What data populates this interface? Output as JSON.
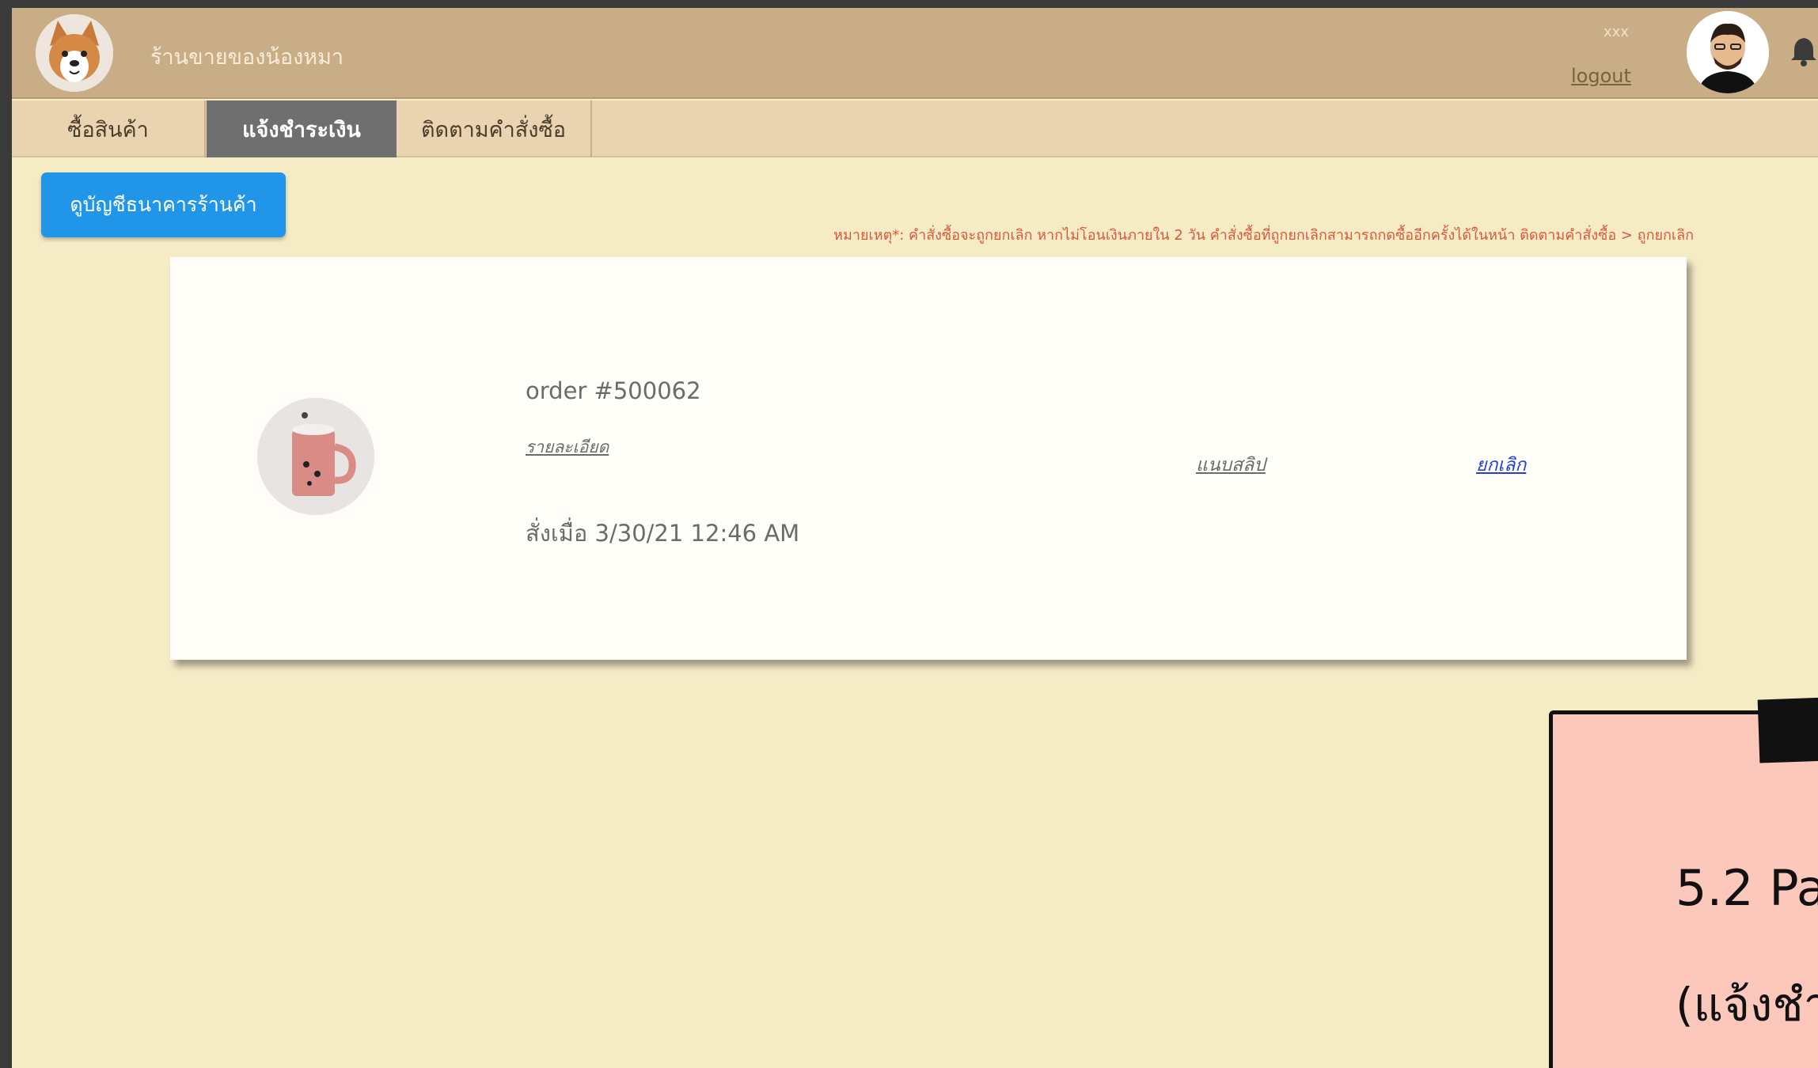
{
  "header": {
    "shop_name": "ร้านขายของน้องหมา",
    "user_name": "xxx",
    "logout_label": "logout",
    "logo_icon": "corgi-logo",
    "avatar_icon": "user-avatar",
    "bell_icon": "bell-icon"
  },
  "tabs": [
    {
      "label": "ซื้อสินค้า"
    },
    {
      "label": "แจ้งชำระเงิน",
      "active": true
    },
    {
      "label": "ติดตามคำสั่งซื้อ"
    }
  ],
  "bank_button_label": "ดูบัญชีธนาคารร้านค้า",
  "note": "หมายเหตุ*: คำสั่งซื้อจะถูกยกเลิก หากไม่โอนเงินภายใน 2 วัน คำสั่งซื้อที่ถูกยกเลิกสามารถกดซื้ออีกครั้งได้ในหน้า ติดตามคำสั่งซื้อ > ถูกยกเลิก",
  "order": {
    "order_no": "order #500062",
    "details_label": "รายละเอียด",
    "date": "สั่งเมื่อ 3/30/21 12:46 AM",
    "slip_label": "แนบสลิป",
    "cancel_label": "ยกเลิก",
    "product_icon": "pink-mug-image"
  },
  "sticky_note": {
    "title": "5.2 Pa",
    "subtitle": "(แจ้งชำ"
  },
  "colors": {
    "page_bg": "#f5ebc5",
    "header_bg": "#c9ad86",
    "tabs_bg": "#e9d3b0",
    "active_tab": "#6f6f6f",
    "button_blue": "#2195e8",
    "note_red": "#d9583c",
    "sticky_bg": "#fcc8bc"
  }
}
